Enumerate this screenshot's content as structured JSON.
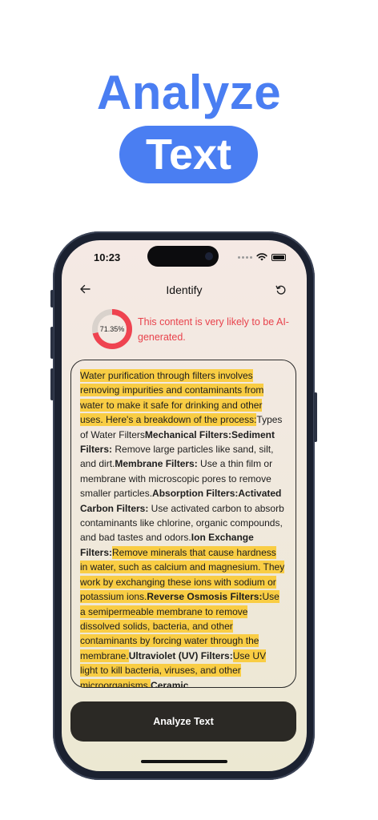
{
  "hero": {
    "line1": "Analyze",
    "line2": "Text"
  },
  "status_bar": {
    "time": "10:23"
  },
  "nav": {
    "title": "Identify",
    "back_icon": "arrow-left-icon",
    "refresh_icon": "refresh-icon"
  },
  "result": {
    "score_label": "71.35%",
    "score_fraction": 0.7135,
    "verdict": "This content is very likely to be AI-generated.",
    "colors": {
      "ai": "#ef4350",
      "human": "#d9d2cc",
      "highlight": "#f9cd44",
      "accent": "#4a7ef2"
    }
  },
  "content": {
    "segments": [
      {
        "text": "Water purification through filters involves removing impurities and contaminants from water to make it safe for drinking and other uses. Here's a breakdown of the process:",
        "highlight": true,
        "bold": false
      },
      {
        "text": "Types of Water Filters",
        "highlight": false,
        "bold": false
      },
      {
        "text": "Mechanical Filters:Sediment Filters:",
        "highlight": false,
        "bold": true
      },
      {
        "text": " Remove large particles like sand, silt, and dirt.",
        "highlight": false,
        "bold": false
      },
      {
        "text": "Membrane Filters:",
        "highlight": false,
        "bold": true
      },
      {
        "text": " Use a thin film or membrane with microscopic pores to remove smaller particles.",
        "highlight": false,
        "bold": false
      },
      {
        "text": "Absorption Filters:Activated Carbon Filters:",
        "highlight": false,
        "bold": true
      },
      {
        "text": " Use activated carbon to absorb contaminants like chlorine, organic compounds, and bad tastes and odors.",
        "highlight": false,
        "bold": false
      },
      {
        "text": "Ion Exchange Filters:",
        "highlight": false,
        "bold": true
      },
      {
        "text": "Remove minerals that cause hardness in water, such as calcium and magnesium. They work by exchanging these ions with sodium or potassium ions.",
        "highlight": true,
        "bold": false
      },
      {
        "text": "Reverse Osmosis Filters:",
        "highlight": true,
        "bold": true
      },
      {
        "text": "Use a semipermeable membrane to remove dissolved solids, bacteria, and other contaminants by forcing water through the membrane.",
        "highlight": true,
        "bold": false
      },
      {
        "text": "Ultraviolet (UV) Filters:",
        "highlight": false,
        "bold": true
      },
      {
        "text": "Use UV light to kill bacteria, viruses, and other microorganisms.",
        "highlight": true,
        "bold": false
      },
      {
        "text": "Ceramic",
        "highlight": false,
        "bold": true
      }
    ]
  },
  "action": {
    "label": "Analyze Text"
  }
}
